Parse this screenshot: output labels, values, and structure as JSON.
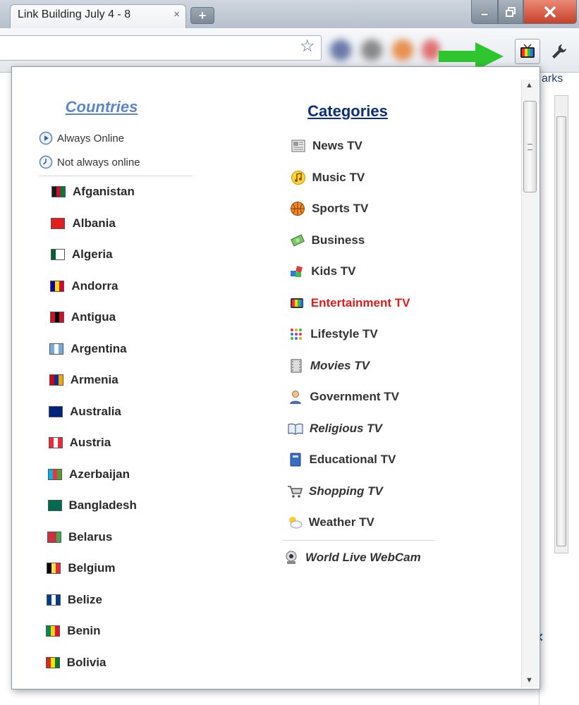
{
  "browser": {
    "tab_title": "Link Building July 4 - 8",
    "tab_close": "×",
    "new_tab": "+",
    "bookmarks_fragment": "arks"
  },
  "popup": {
    "countries_heading": "Countries",
    "categories_heading": "Categories",
    "legend": [
      {
        "icon": "play-circle-icon",
        "label": "Always Online"
      },
      {
        "icon": "clock-icon",
        "label": "Not always online"
      }
    ],
    "countries": [
      {
        "name": "Afganistan",
        "flag": [
          "#1a1a1a",
          "#c8102e",
          "#007a36"
        ]
      },
      {
        "name": "Albania",
        "flag": [
          "#e41e20",
          "#e41e20",
          "#e41e20"
        ]
      },
      {
        "name": "Algeria",
        "flag": [
          "#006233",
          "#ffffff",
          "#ffffff"
        ]
      },
      {
        "name": "Andorra",
        "flag": [
          "#10069f",
          "#fedf00",
          "#d50032"
        ]
      },
      {
        "name": "Antigua",
        "flag": [
          "#ce1126",
          "#000000",
          "#ce1126"
        ]
      },
      {
        "name": "Argentina",
        "flag": [
          "#74acdf",
          "#ffffff",
          "#74acdf"
        ]
      },
      {
        "name": "Armenia",
        "flag": [
          "#d90012",
          "#0033a0",
          "#f2a800"
        ]
      },
      {
        "name": "Australia",
        "flag": [
          "#00247d",
          "#00247d",
          "#00247d"
        ]
      },
      {
        "name": "Austria",
        "flag": [
          "#ed2939",
          "#ffffff",
          "#ed2939"
        ]
      },
      {
        "name": "Azerbaijan",
        "flag": [
          "#00b5e2",
          "#ef3340",
          "#509e2f"
        ]
      },
      {
        "name": "Bangladesh",
        "flag": [
          "#006a4e",
          "#006a4e",
          "#006a4e"
        ]
      },
      {
        "name": "Belarus",
        "flag": [
          "#c8313e",
          "#c8313e",
          "#4aa657"
        ]
      },
      {
        "name": "Belgium",
        "flag": [
          "#000000",
          "#fae042",
          "#ed2939"
        ]
      },
      {
        "name": "Belize",
        "flag": [
          "#003f87",
          "#ffffff",
          "#003f87"
        ]
      },
      {
        "name": "Benin",
        "flag": [
          "#008751",
          "#fcd116",
          "#e8112d"
        ]
      },
      {
        "name": "Bolivia",
        "flag": [
          "#d52b1e",
          "#f9e300",
          "#007934"
        ]
      }
    ],
    "categories": [
      {
        "label": "News TV",
        "icon": "newspaper-icon",
        "style": "normal"
      },
      {
        "label": "Music TV",
        "icon": "music-note-icon",
        "style": "normal"
      },
      {
        "label": "Sports TV",
        "icon": "basketball-icon",
        "style": "normal"
      },
      {
        "label": "Business",
        "icon": "money-icon",
        "style": "normal"
      },
      {
        "label": "Kids TV",
        "icon": "blocks-icon",
        "style": "normal"
      },
      {
        "label": "Entertainment TV",
        "icon": "tv-icon",
        "style": "highlight"
      },
      {
        "label": "Lifestyle TV",
        "icon": "grid-icon",
        "style": "normal"
      },
      {
        "label": "Movies TV",
        "icon": "film-icon",
        "style": "italic"
      },
      {
        "label": "Government TV",
        "icon": "person-icon",
        "style": "normal"
      },
      {
        "label": "Religious TV",
        "icon": "book-icon",
        "style": "italic"
      },
      {
        "label": "Educational TV",
        "icon": "notebook-icon",
        "style": "normal"
      },
      {
        "label": "Shopping TV",
        "icon": "cart-icon",
        "style": "italic"
      },
      {
        "label": "Weather TV",
        "icon": "sun-cloud-icon",
        "style": "normal"
      }
    ],
    "extra_category": {
      "label": "World Live WebCam",
      "icon": "webcam-icon"
    }
  },
  "colors": {
    "countries_heading": "#5b86c8",
    "categories_heading": "#0b2e80",
    "highlight": "#e01b1b",
    "arrow": "#2ec52e"
  }
}
